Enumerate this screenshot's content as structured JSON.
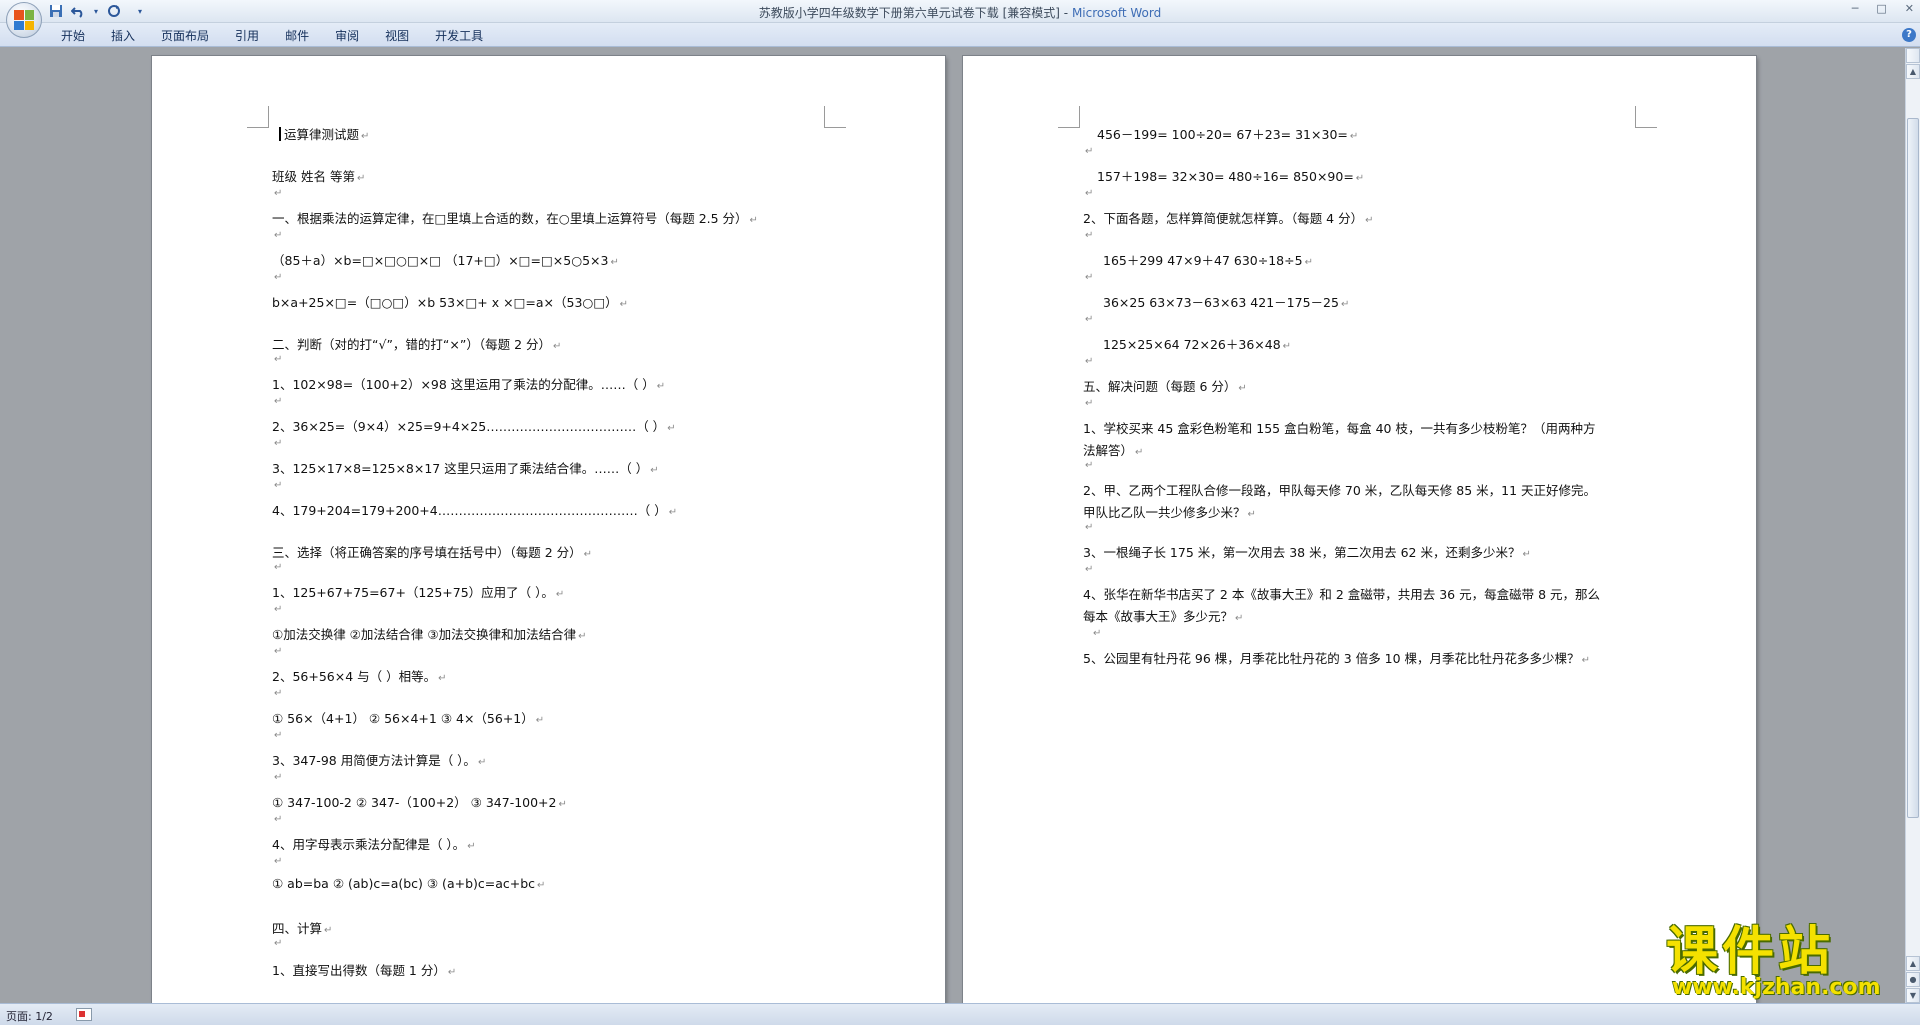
{
  "window": {
    "title_doc": "苏教版小学四年级数学下册第六单元试卷下载 [兼容模式]",
    "title_sep": " - ",
    "title_app": "Microsoft Word",
    "minimize": "─",
    "restore": "□",
    "close": "✕"
  },
  "quick_access": {
    "save_icon": "save-icon",
    "undo_icon": "undo-icon",
    "redo_icon": "redo-icon",
    "more": "▾"
  },
  "ribbon": {
    "tabs": [
      "开始",
      "插入",
      "页面布局",
      "引用",
      "邮件",
      "审阅",
      "视图",
      "开发工具"
    ],
    "help": "?"
  },
  "page1": {
    "lines": [
      "运算律测试题",
      "班级              姓名             等第",
      "一、根据乘法的运算定律，在□里填上合适的数，在○里填上运算符号（每题 2.5 分）",
      "（85＋a）×b=□×□○□×□        （17+□）×□=□×5○5×3",
      "b×a+25×□=（□○□）×b         53×□+ x ×□=a×（53○□）",
      "二、判断（对的打“√”，错的打“×”）（每题 2 分）",
      "1、102×98=（100+2）×98 这里运用了乘法的分配律。……（     ）",
      "2、36×25=（9×4）×25=9+4×25………………………………（     ）",
      "3、125×17×8=125×8×17 这里只运用了乘法结合律。……（    ）",
      "4、179+204=179+200+4…………………………………………（     ）",
      "三、选择（将正确答案的序号填在括号中）（每题 2 分）",
      "1、125+67+75=67+（125+75）应用了（         ）。",
      "①加法交换律      ②加法结合律      ③加法交换律和加法结合律",
      "2、56+56×4 与（           ）相等。",
      "①  56×（4+1）    ②  56×4+1    ③  4×（56+1）",
      "3、347-98 用简便方法计算是（           ）。",
      "①  347-100-2     ②  347-（100+2）    ③  347-100+2",
      "4、用字母表示乘法分配律是（          ）。",
      "①  ab=ba     ②  (ab)c=a(bc)       ③  (a+b)c=ac+bc",
      "四、计算",
      "1、直接写出得数（每题 1 分）"
    ]
  },
  "page2": {
    "lines": [
      "456－199=       100÷20=        67＋23=          31×30=",
      "157＋198=       32×30=         480÷16=          850×90=",
      "2、下面各题，怎样算简便就怎样算。（每题 4 分）",
      "165＋299           47×9＋47           630÷18÷5",
      "36×25              63×73－63×63      421－175－25",
      "125×25×64                          72×26＋36×48",
      "五、解决问题（每题 6 分）",
      "1、学校买来 45 盒彩色粉笔和 155 盒白粉笔，每盒 40 枝，一共有多少枝粉笔？（用两种方",
      "法解答）",
      "2、甲、乙两个工程队合修一段路，甲队每天修 70 米，乙队每天修 85 米，11 天正好修完。",
      "甲队比乙队一共少修多少米？",
      "3、一根绳子长 175 米，第一次用去 38 米，第二次用去 62 米，还剩多少米？",
      "4、张华在新华书店买了 2 本《故事大王》和 2 盒磁带，共用去 36 元，每盒磁带 8 元，那么",
      "每本《故事大王》多少元？",
      "5、公园里有牡丹花 96 棵，月季花比牡丹花的 3 倍多 10 棵，月季花比牡丹花多多少棵？"
    ]
  },
  "paragraph_mark": "↵",
  "status": {
    "page": "页面: 1/2"
  },
  "watermark": {
    "text": "课件站",
    "url": "www.kjzhan.com"
  },
  "colors": {
    "title_app": "#3e6db5",
    "workspace": "#9fa3a8",
    "watermark": "#f4e100"
  }
}
